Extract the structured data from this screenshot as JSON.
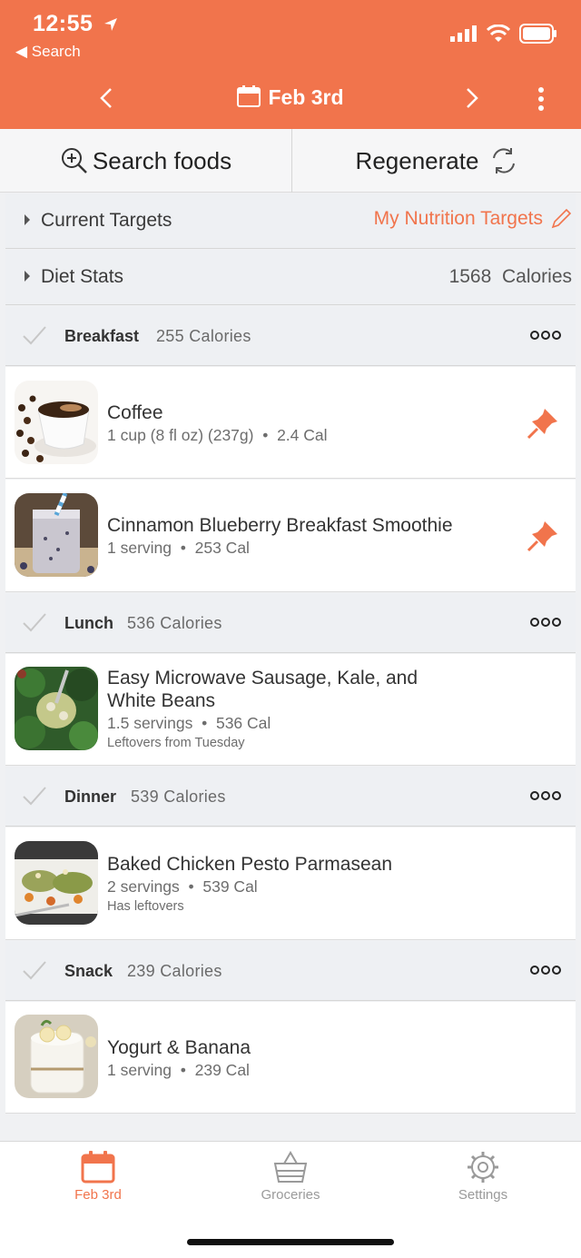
{
  "status": {
    "time": "12:55",
    "back_label": "Search"
  },
  "nav": {
    "date_title": "Feb 3rd"
  },
  "actions": {
    "search_label": "Search foods",
    "regenerate_label": "Regenerate"
  },
  "current_targets": {
    "label": "Current Targets",
    "link": "My Nutrition Targets"
  },
  "diet_stats": {
    "label": "Diet Stats",
    "value": "1568",
    "unit": "Calories"
  },
  "meals": [
    {
      "name": "Breakfast",
      "calories": "255 Calories",
      "items": [
        {
          "title": "Coffee",
          "serving": "1 cup (8 fl oz) (237g)",
          "cal": "2.4 Cal",
          "note": "",
          "pinned": true
        },
        {
          "title": "Cinnamon Blueberry Breakfast Smoothie",
          "serving": "1 serving",
          "cal": "253 Cal",
          "note": "",
          "pinned": true
        }
      ]
    },
    {
      "name": "Lunch",
      "calories": "536 Calories",
      "items": [
        {
          "title_line1": "Easy Microwave Sausage, Kale, and",
          "title_line2": "White Beans",
          "serving": "1.5 servings",
          "cal": "536 Cal",
          "note": "Leftovers from Tuesday",
          "pinned": false
        }
      ]
    },
    {
      "name": "Dinner",
      "calories": "539 Calories",
      "items": [
        {
          "title": "Baked Chicken Pesto Parmasean",
          "serving": "2 servings",
          "cal": "539 Cal",
          "note": "Has leftovers",
          "pinned": false
        }
      ]
    },
    {
      "name": "Snack",
      "calories": "239 Calories",
      "items": [
        {
          "title": "Yogurt & Banana",
          "serving": "1 serving",
          "cal": "239 Cal",
          "note": "",
          "pinned": false
        }
      ]
    }
  ],
  "tabs": [
    {
      "label": "Feb 3rd",
      "icon": "calendar-icon",
      "active": true
    },
    {
      "label": "Groceries",
      "icon": "basket-icon",
      "active": false
    },
    {
      "label": "Settings",
      "icon": "gear-icon",
      "active": false
    }
  ],
  "separator": "•",
  "colors": {
    "accent": "#f1744c",
    "section_bg": "#eef0f3",
    "text": "#333333",
    "muted": "#6d6d6d"
  }
}
